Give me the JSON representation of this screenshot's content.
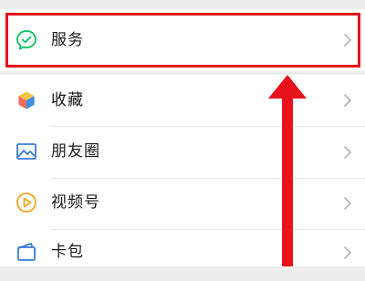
{
  "menu": {
    "items": [
      {
        "label": "服务",
        "icon": "wechat-pay-check-icon"
      },
      {
        "label": "收藏",
        "icon": "cube-icon"
      },
      {
        "label": "朋友圈",
        "icon": "image-icon"
      },
      {
        "label": "视频号",
        "icon": "video-play-icon"
      },
      {
        "label": "卡包",
        "icon": "wallet-card-icon"
      }
    ]
  },
  "annotation": {
    "highlight_color": "#e8121c",
    "target_item": "服务"
  },
  "colors": {
    "accent_green": "#07c160",
    "accent_orange": "#f5a623",
    "accent_blue": "#3a7bd5",
    "background": "#ededed"
  }
}
